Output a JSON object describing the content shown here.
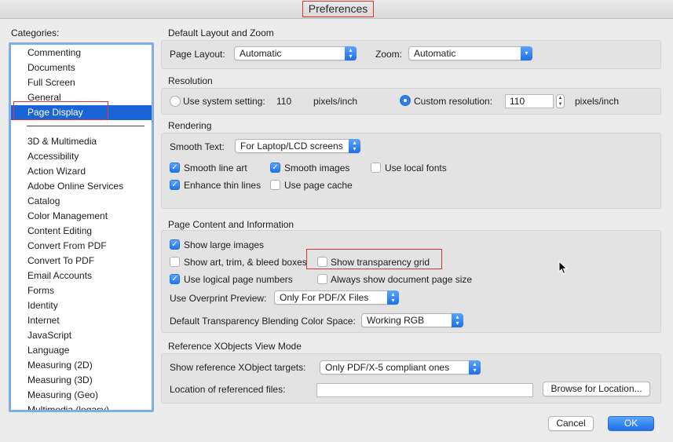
{
  "window": {
    "title": "Preferences"
  },
  "categories": {
    "label": "Categories:",
    "group1": [
      "Commenting",
      "Documents",
      "Full Screen",
      "General",
      "Page Display"
    ],
    "selected": "Page Display",
    "group2": [
      "3D & Multimedia",
      "Accessibility",
      "Action Wizard",
      "Adobe Online Services",
      "Catalog",
      "Color Management",
      "Content Editing",
      "Convert From PDF",
      "Convert To PDF",
      "Email Accounts",
      "Forms",
      "Identity",
      "Internet",
      "JavaScript",
      "Language",
      "Measuring (2D)",
      "Measuring (3D)",
      "Measuring (Geo)",
      "Multimedia (legacy)"
    ]
  },
  "layout_zoom": {
    "title": "Default Layout and Zoom",
    "page_layout_label": "Page Layout:",
    "page_layout_value": "Automatic",
    "zoom_label": "Zoom:",
    "zoom_value": "Automatic"
  },
  "resolution": {
    "title": "Resolution",
    "use_system_label": "Use system setting:",
    "system_value": "110",
    "system_unit": "pixels/inch",
    "custom_label": "Custom resolution:",
    "custom_value": "110",
    "custom_unit": "pixels/inch",
    "selected": "custom"
  },
  "rendering": {
    "title": "Rendering",
    "smooth_text_label": "Smooth Text:",
    "smooth_text_value": "For Laptop/LCD screens",
    "smooth_line_art": {
      "label": "Smooth line art",
      "checked": true
    },
    "smooth_images": {
      "label": "Smooth images",
      "checked": true
    },
    "use_local_fonts": {
      "label": "Use local fonts",
      "checked": false
    },
    "enhance_thin_lines": {
      "label": "Enhance thin lines",
      "checked": true
    },
    "use_page_cache": {
      "label": "Use page cache",
      "checked": false
    }
  },
  "page_content": {
    "title": "Page Content and Information",
    "show_large_images": {
      "label": "Show large images",
      "checked": true
    },
    "show_art_trim_bleed": {
      "label": "Show art, trim, & bleed boxes",
      "checked": false
    },
    "show_transparency_grid": {
      "label": "Show transparency grid",
      "checked": false
    },
    "use_logical_page_numbers": {
      "label": "Use logical page numbers",
      "checked": true
    },
    "always_show_doc_page_size": {
      "label": "Always show document page size",
      "checked": false
    },
    "overprint_label": "Use Overprint Preview:",
    "overprint_value": "Only For PDF/X Files",
    "blending_label": "Default Transparency Blending Color Space:",
    "blending_value": "Working RGB"
  },
  "xobjects": {
    "title": "Reference XObjects View Mode",
    "show_targets_label": "Show reference XObject targets:",
    "show_targets_value": "Only PDF/X-5 compliant ones",
    "location_label": "Location of referenced files:",
    "location_value": "",
    "browse_label": "Browse for Location..."
  },
  "footer": {
    "cancel_label": "Cancel",
    "ok_label": "OK"
  },
  "colors": {
    "accent": "#1a64d8",
    "highlight_border": "#e0352b",
    "list_border": "#7eaee8"
  }
}
